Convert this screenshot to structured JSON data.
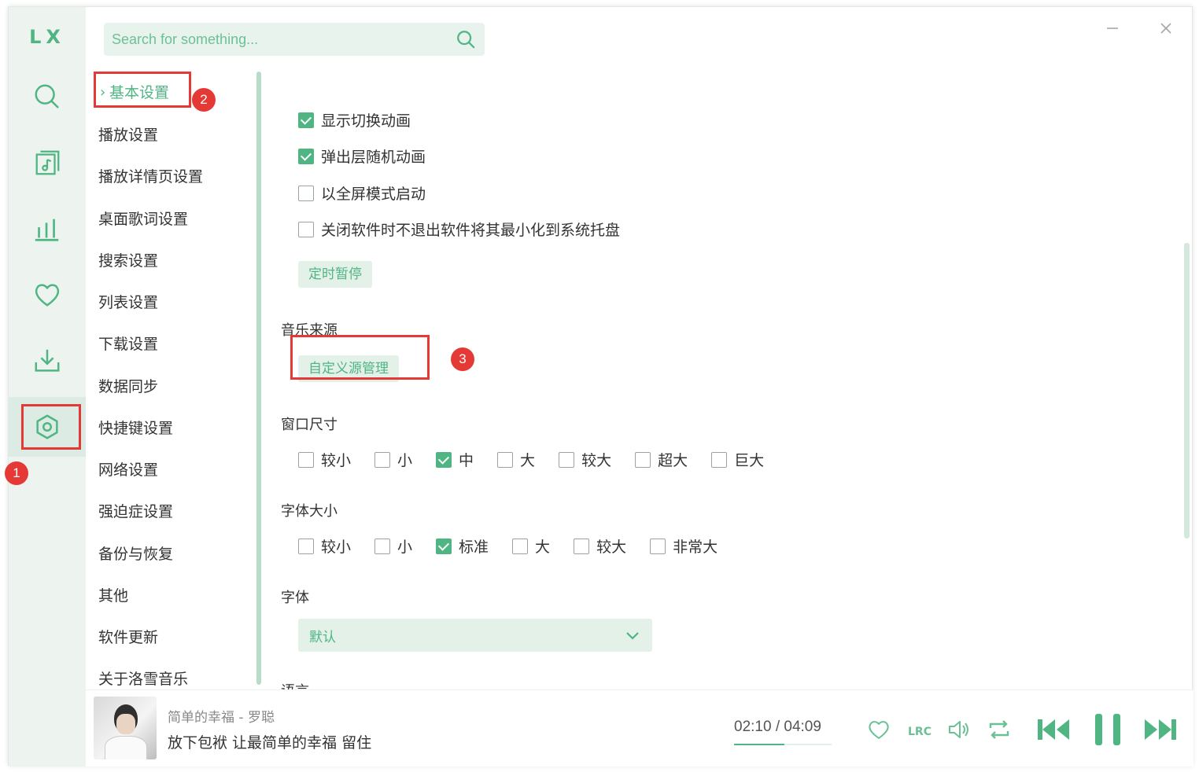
{
  "app": {
    "logo": "LX"
  },
  "search": {
    "placeholder": "Search for something..."
  },
  "settings_nav": {
    "items": [
      "基本设置",
      "播放设置",
      "播放详情页设置",
      "桌面歌词设置",
      "搜索设置",
      "列表设置",
      "下载设置",
      "数据同步",
      "快捷键设置",
      "网络设置",
      "强迫症设置",
      "备份与恢复",
      "其他",
      "软件更新",
      "关于洛雪音乐"
    ],
    "active_index": 0
  },
  "content": {
    "toggles": [
      {
        "label": "显示切换动画",
        "checked": true
      },
      {
        "label": "弹出层随机动画",
        "checked": true
      },
      {
        "label": "以全屏模式启动",
        "checked": false
      },
      {
        "label": "关闭软件时不退出软件将其最小化到系统托盘",
        "checked": false
      }
    ],
    "timer_button": "定时暂停",
    "music_source": {
      "title": "音乐来源",
      "button": "自定义源管理"
    },
    "window_size": {
      "title": "窗口尺寸",
      "options": [
        "较小",
        "小",
        "中",
        "大",
        "较大",
        "超大",
        "巨大"
      ],
      "selected": "中"
    },
    "font_size": {
      "title": "字体大小",
      "options": [
        "较小",
        "小",
        "标准",
        "大",
        "较大",
        "非常大"
      ],
      "selected": "标准"
    },
    "font": {
      "title": "字体",
      "value": "默认"
    },
    "language": {
      "title": "语言"
    }
  },
  "annotations": {
    "badge1": "1",
    "badge2": "2",
    "badge3": "3"
  },
  "player": {
    "song": "简单的幸福 - 罗聪",
    "lyric": "放下包袱 让最简单的幸福 留住",
    "time": "02:10 / 04:09",
    "progress": 0.52
  },
  "colors": {
    "accent": "#4fb583",
    "annotation": "#e53935"
  }
}
